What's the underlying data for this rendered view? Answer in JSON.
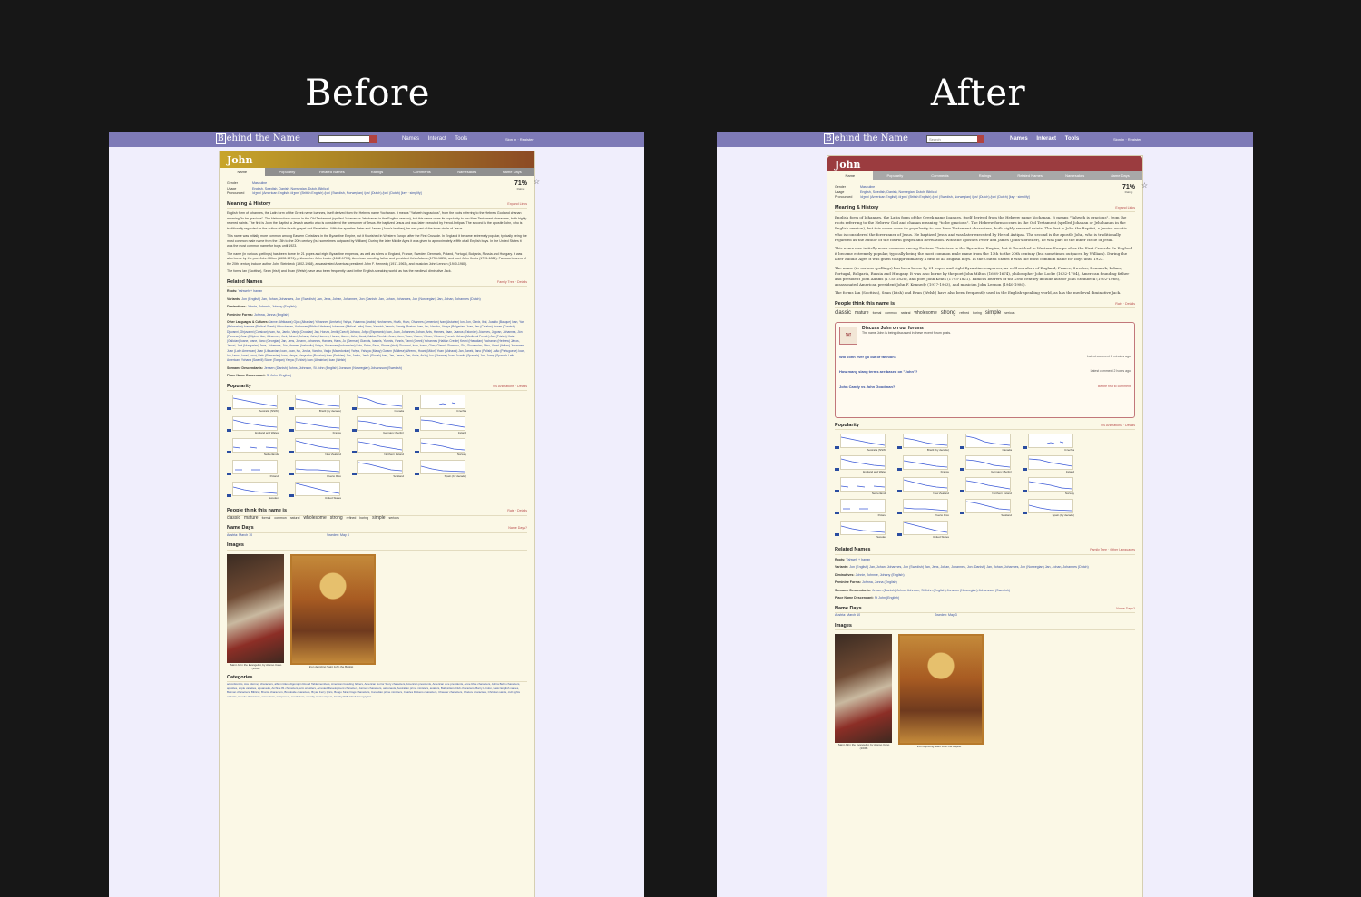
{
  "headings": {
    "before": "Before",
    "after": "After"
  },
  "site": {
    "logo_box": "B",
    "logo_rest": "ehind the Name",
    "search_placeholder": "Search",
    "nav": {
      "names": "Names",
      "interact": "Interact",
      "tools": "Tools"
    },
    "sign_in": "Sign in",
    "register": "Register"
  },
  "name": "John",
  "tabs": [
    "Name",
    "Popularity",
    "Related Names",
    "Ratings",
    "Comments",
    "Namesakes",
    "Name Days"
  ],
  "tabs_after": [
    "Name",
    "Popularity",
    "Comments",
    "Ratings",
    "Related Names",
    "Namesakes",
    "Name Days"
  ],
  "rating": {
    "percent": "71%",
    "label": "Rating",
    "save": "Save"
  },
  "info": {
    "gender_label": "Gender",
    "gender": "Masculine",
    "usage_label": "Usage",
    "usage": "English, Swedish, Danish, Norwegian, Dutch, Biblical",
    "pron_label": "Pronounced",
    "pron": "/dʒɒn/ (American English)   /dʒɒn/ (British English)   /jɔn/ (Swedish, Norwegian)   /jɔn/ (Dutch)   /jɔn/ (Dutch)   [key · simplify]"
  },
  "meaning": {
    "title": "Meaning & History",
    "link": "Expand Links",
    "p1": "English form of Iohannes, the Latin form of the Greek name Ioannes, itself derived from the Hebrew name Yochanan. It means \"Yahweh is gracious\", from the roots referring to the Hebrew God and chanan meaning \"to be gracious\". The Hebrew form occurs in the Old Testament (spelled Johanan or Jehohanan in the English version), but this name owes its popularity to two New Testament characters, both highly revered saints. The first is John the Baptist, a Jewish ascetic who is considered the forerunner of Jesus. He baptized Jesus and was later executed by Herod Antipas. The second is the apostle John, who is traditionally regarded as the author of the fourth gospel and Revelation. With the apostles Peter and James (John's brother), he was part of the inner circle of Jesus.",
    "p2": "This name was initially more common among Eastern Christians in the Byzantine Empire, but it flourished in Western Europe after the First Crusade. In England it became extremely popular, typically being the most common male name from the 13th to the 20th century (but sometimes outpaced by William). During the later Middle Ages it was given to approximately a fifth of all English boys. In the United States it was the most common name for boys until 1923.",
    "p3": "The name (in various spellings) has been borne by 21 popes and eight Byzantine emperors, as well as rulers of England, France, Sweden, Denmark, Poland, Portugal, Bulgaria, Russia and Hungary. It was also borne by the poet John Milton (1608-1674), philosopher John Locke (1632-1704), American founding father and president John Adams (1735-1826), and poet John Keats (1795-1821). Famous bearers of the 20th century include author John Steinbeck (1902-1968), assassinated American president John F. Kennedy (1917-1963), and musician John Lennon (1940-1980).",
    "p4": "The forms Ian (Scottish), Sean (Irish) and Evan (Welsh) have also been frequently used in the English-speaking world, as has the medieval diminutive Jack."
  },
  "related": {
    "title": "Related Names",
    "link": "Family Tree · Details",
    "link_after": "Family Tree · Other Languages",
    "rows": [
      {
        "label": "Roots:",
        "value": "Yahweh + hanan"
      },
      {
        "label": "Variants:",
        "value": "Jon (English)   Jan, Johan, Johannes, Jon (Swedish)   Jan, Jens, Johan, Johannes, Jon (Danish)   Jan, Johan, Johannes, Jon (Norwegian)   Jan, Johan, Johannes (Dutch)"
      },
      {
        "label": "Diminutives:",
        "value": "Johnie, Johnnie, Johnny (English)"
      },
      {
        "label": "Feminine Forms:",
        "value": "Johnna, Jonna (English)"
      },
      {
        "label": "Other Languages & Cultures:",
        "value": "Janne (Afrikaans)  Gjon (Albanian)  Yohannes (Amharic)  Yahya, Yuhanna (Arabic)  Hovhannes, Hovik, Hovo, Ohannes (Armenian)  Ivan (Asturian)  Ion, Jon, Ganix, Ibai, Juanito (Basque)  Ivan, Yan (Belarusian)  Ioannes (Biblical Greek)  Yehochanan, Yochanan (Biblical Hebrew)  Iohannes (Biblical Latin)  Yann, Yannick, Yannic, Yannig (Breton)  Ivan, Ivo, Vancho, Vanya (Bulgarian)  Joan, Jan (Catalan)  Jowan (Cornish)  Djuvanni, Ghjuvanni (Corsican)  Ivan, Ivo, Janko, Vanja (Croatian)  Jan, Honza, Jenik (Czech)  Johano, Jofpo (Esperanto)  Ivan, Juan, Johannes, Johan, Ants, Hannes, Jaan, Jaanus (Estonian)  Jóannes, Jógvan, Jóhannes, Jón (Faroese)  Juan (Filipino)  Jan, Johannes, Joni, Juhani, Juhana, Juho, Hannes, Hannu, Janne, Juha, Jussi, Jukka (Finnish)  Jean, Yann, Yoan, Yoann, Yohan, Yohann (French)  Jehan (Medieval French)  Jan (Frisian)  Xoán (Galician)  Ioane, Ivane, Vano (Georgian)  Jan, Jens, Johann, Johannes, Hannes, Hans, Jo (German)  Giannis, Ioannis, Yiannis, Yannis, Yanni (Greek)  Yohannes (Haitian Creole)  Keoni (Hawaiian)  Yochanan (Hebrew)  János, Jancsi, Jani (Hungarian)  Jens, Jóhannes, Jón, Hannes (Icelandic)  Yahya, Yohannes (Indonesian)  Eoin, Seán, Sean, Shane (Irish)  Giovanni, Ivan, Ivano, Gian, Gianni, Giannino, Gio, Giovannino, Nino, Vanni (Italian)  Johannes, Juan (Latin American)  Juan (Lithuanian)  Ioan, Joan, Ivo, Jovica, Vancho, Vanjo (Macedonian)  Yahya, Yahaya (Malay)  Gwann (Maltese)  Wiremu, Hoani (Māori)  Yoan (Mohawk)  Jan, Janek, Jano (Polish)  João (Portuguese)  Ioan, Ion, Iancu, Ionel, Ionuț, Nelu (Romanian)  Ivan, Vanya, Vanyusha (Russian)  Ivan (Serbian)  Ján, Janko, Janík (Slovak)  Ivan, Jan, Janez, Žan, Anže, Anžej, Ivo (Slovene)  Juan, Juanito (Spanish)  Jon, Jonny (Spanish Latin American)  Yohana (Swahili)  Sione (Tongan)  Yahya (Turkish)  Ivan (Ukrainian)  Ioan (Welsh)"
      },
      {
        "label": "Surname Descendants:",
        "value": "Jensen (Danish)  Johns, Johnson, St John (English)  Jonsson (Norwegian)  Johansson (Swedish)"
      },
      {
        "label": "Place Name Descendant:",
        "value": "St John (English)"
      }
    ]
  },
  "popularity": {
    "title": "Popularity",
    "link": "US Animations · Details",
    "charts": [
      "Australia (NSW)",
      "Brazil (by decade)",
      "Canada",
      "Czechia",
      "England and Wales",
      "France",
      "Germany (Berlin)",
      "Ireland",
      "Netherlands",
      "New Zealand",
      "Northern Ireland",
      "Norway",
      "Poland",
      "Puerto Rico",
      "Scotland",
      "Spain (by decade)",
      "Sweden",
      "United States"
    ]
  },
  "people": {
    "title": "People think this name is",
    "link": "Rate · Details",
    "words": [
      "classic",
      "mature",
      "formal",
      "common",
      "natural",
      "wholesome",
      "strong",
      "refined",
      "boring",
      "simple",
      "serious"
    ]
  },
  "forum": {
    "title": "Discuss John on our forums",
    "subtitle": "The name John is being discussed in these recent forum posts.",
    "posts": [
      {
        "title": "Will John ever go out of fashion?",
        "meta": "Latest comment 3 minutes ago"
      },
      {
        "title": "How many slang terms are based on \"John\"?",
        "meta": "Latest comment 2 hours ago"
      },
      {
        "title": "John Candy vs John Goodman?",
        "meta": "Be the first to comment"
      }
    ]
  },
  "name_days": {
    "title": "Name Days",
    "link": "Name Days?",
    "austria": "Austria: March 10",
    "sweden": "Sweden: May 3"
  },
  "images": {
    "title": "Images",
    "cap1": "Saint John the Evangelist, by Alonso Cano (1636)",
    "cap2": "Icon depicting Saint John the Baptist"
  },
  "categories": {
    "title": "Categories",
    "text": "accordionists, Ace Attorney characters, album titles, Algonquin Round Table members, American founding fathers, American Horror Story characters, American presidents, American vice presidents, Anne Rice characters, Aphra Behn characters, apostles, apple varieties, aquanauts, Archive 81 characters, arm wrestlers, Arrested Development characters, Asimov characters, astronauts, Australian prime ministers, aviators, Babysitters Club characters, Barry Lyndon, basic English names, Batman characters, Biblical, Brontë characters, Brookside characters, Bryan Ferry lyrics, Bungo Stray Dogs characters, Canadian prime ministers, Charles Dickens characters, Chaucer characters, Chekov characters, Christian saints, civil rights activists, Cluedo characters, comedians, composers, conductors, country music singers, Crosby Stills Nash Young lyrics"
  }
}
